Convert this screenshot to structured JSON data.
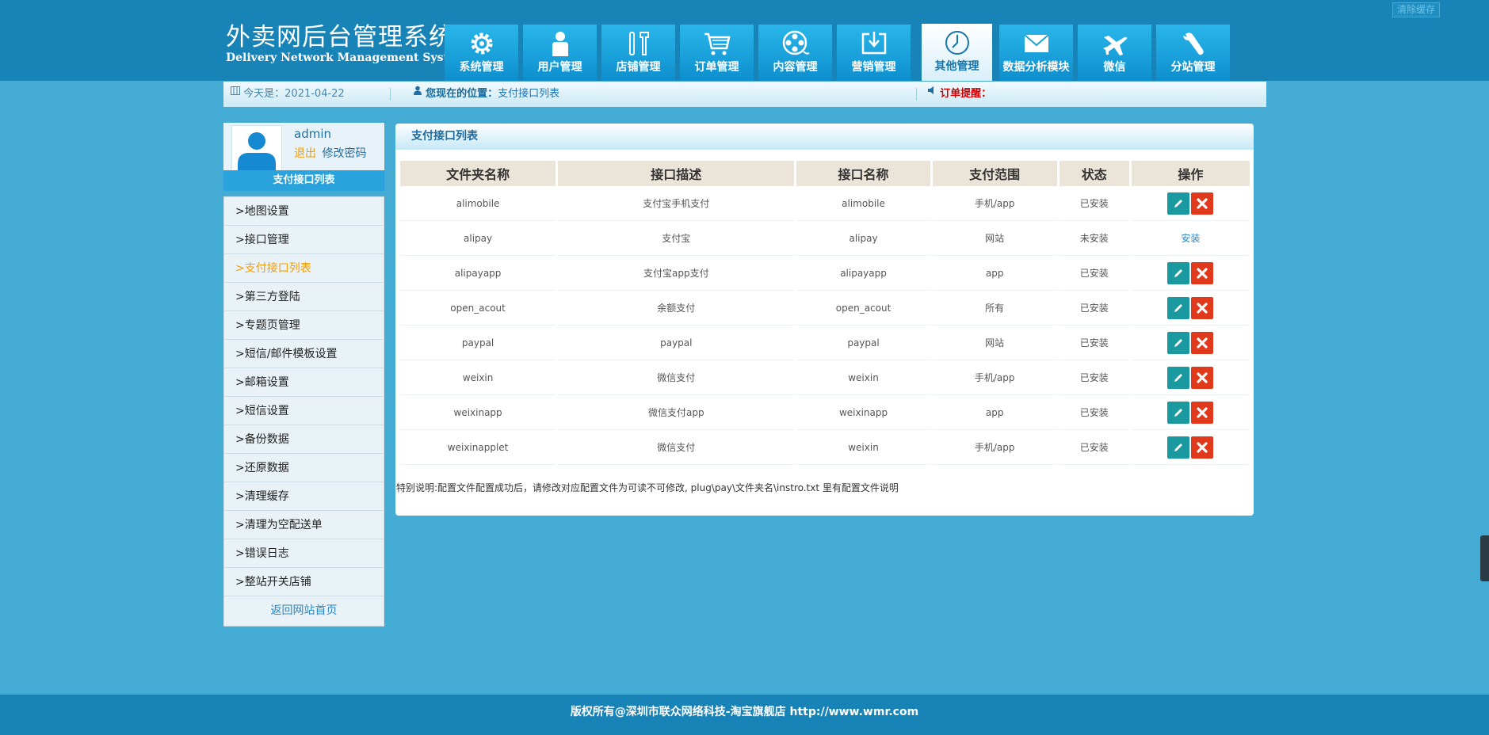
{
  "header": {
    "title_cn": "外卖网后台管理系统",
    "title_en": "Delivery Network Management System",
    "clear_cache_label": "清除缓存"
  },
  "nav": {
    "items": [
      {
        "label": "系统管理",
        "icon": "gear-icon"
      },
      {
        "label": "用户管理",
        "icon": "user-icon"
      },
      {
        "label": "店铺管理",
        "icon": "tools-icon"
      },
      {
        "label": "订单管理",
        "icon": "cart-icon"
      },
      {
        "label": "内容管理",
        "icon": "film-reel-icon"
      },
      {
        "label": "营销管理",
        "icon": "download-box-icon"
      },
      {
        "label": "其他管理",
        "icon": "clock-icon",
        "active": true
      },
      {
        "label": "数据分析模块",
        "icon": "envelope-icon"
      },
      {
        "label": "微信",
        "icon": "plane-icon"
      },
      {
        "label": "分站管理",
        "icon": "wrench-icon"
      }
    ]
  },
  "infobar": {
    "today_label": "今天是：",
    "today_value": "2021-04-22",
    "location_label": "您现在的位置：",
    "location_value": "支付接口列表",
    "order_alert_label": "订单提醒："
  },
  "user": {
    "name": "admin",
    "logout_label": "退出",
    "change_password_label": "修改密码"
  },
  "sidebar": {
    "title": "支付接口列表",
    "items": [
      {
        "label": ">地图设置"
      },
      {
        "label": ">接口管理"
      },
      {
        "label": ">支付接口列表",
        "active": true
      },
      {
        "label": ">第三方登陆"
      },
      {
        "label": ">专题页管理"
      },
      {
        "label": ">短信/邮件模板设置"
      },
      {
        "label": ">邮箱设置"
      },
      {
        "label": ">短信设置"
      },
      {
        "label": ">备份数据"
      },
      {
        "label": ">还原数据"
      },
      {
        "label": ">清理缓存"
      },
      {
        "label": ">清理为空配送单"
      },
      {
        "label": ">错误日志"
      },
      {
        "label": ">整站开关店铺"
      }
    ],
    "home_link": "返回网站首页"
  },
  "panel": {
    "title": "支付接口列表",
    "columns": [
      "文件夹名称",
      "接口描述",
      "接口名称",
      "支付范围",
      "状态",
      "操作"
    ],
    "rows": [
      {
        "folder": "alimobile",
        "desc": "支付宝手机支付",
        "name": "alimobile",
        "scope": "手机/app",
        "status": "已安装",
        "installed": true
      },
      {
        "folder": "alipay",
        "desc": "支付宝",
        "name": "alipay",
        "scope": "网站",
        "status": "未安装",
        "installed": false,
        "action_label": "安装"
      },
      {
        "folder": "alipayapp",
        "desc": "支付宝app支付",
        "name": "alipayapp",
        "scope": "app",
        "status": "已安装",
        "installed": true
      },
      {
        "folder": "open_acout",
        "desc": "余额支付",
        "name": "open_acout",
        "scope": "所有",
        "status": "已安装",
        "installed": true
      },
      {
        "folder": "paypal",
        "desc": "paypal",
        "name": "paypal",
        "scope": "网站",
        "status": "已安装",
        "installed": true
      },
      {
        "folder": "weixin",
        "desc": "微信支付",
        "name": "weixin",
        "scope": "手机/app",
        "status": "已安装",
        "installed": true
      },
      {
        "folder": "weixinapp",
        "desc": "微信支付app",
        "name": "weixinapp",
        "scope": "app",
        "status": "已安装",
        "installed": true
      },
      {
        "folder": "weixinapplet",
        "desc": "微信支付",
        "name": "weixin",
        "scope": "手机/app",
        "status": "已安装",
        "installed": true
      }
    ],
    "note": "特别说明:配置文件配置成功后，请修改对应配置文件为可读不可修改, plug\\pay\\文件夹名\\instro.txt 里有配置文件说明"
  },
  "footer": {
    "copyright": "版权所有@深圳市联众网络科技-淘宝旗舰店 http://www.wmr.com"
  },
  "colors": {
    "page_bg": "#44acd4",
    "header_bg": "#1883b7",
    "nav_tile": "#1ba3dc",
    "edit_button": "#1a9aa0",
    "delete_button": "#e0391c",
    "active_link": "#f59c00"
  }
}
